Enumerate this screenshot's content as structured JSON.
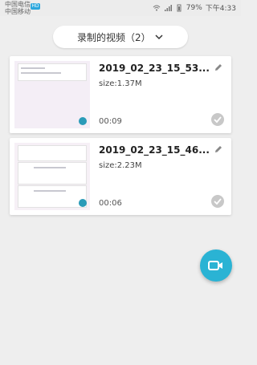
{
  "status_bar": {
    "carrier1": "中国电信",
    "carrier2": "中国移动",
    "badge": "HD",
    "battery": "79%",
    "time": "下午4:33"
  },
  "filter": {
    "label": "录制的视频（2）"
  },
  "videos": [
    {
      "title": "2019_02_23_15_53...",
      "size": "size:1.37M",
      "duration": "00:09"
    },
    {
      "title": "2019_02_23_15_46...",
      "size": "size:2.23M",
      "duration": "00:06"
    }
  ],
  "icons": {
    "edit": "pencil-icon",
    "select": "check-circle-icon",
    "record": "video-camera-icon"
  },
  "colors": {
    "accent": "#2ab3d4",
    "background": "#eeeeee"
  }
}
